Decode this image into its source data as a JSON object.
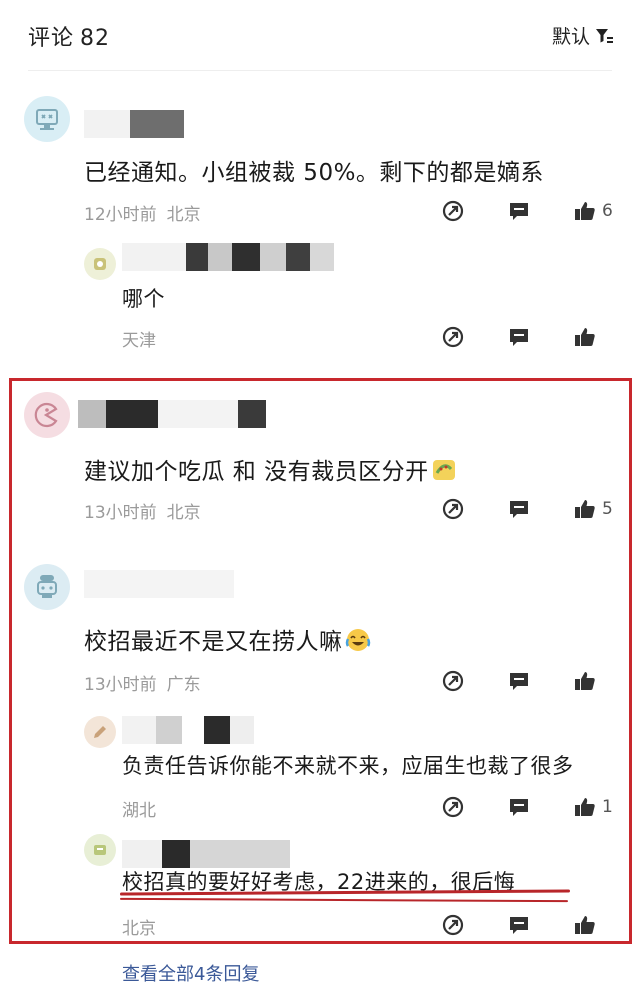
{
  "header": {
    "title": "评论",
    "count": "82",
    "sort_label": "默认"
  },
  "comments": [
    {
      "text": "已经通知。小组被裁 50%。剩下的都是嫡系",
      "time": "12小时前",
      "location": "北京",
      "likes": "6",
      "reply": {
        "text": "哪个",
        "location": "天津",
        "likes": ""
      }
    },
    {
      "text": "建议加个吃瓜 和 没有裁员区分开",
      "time": "13小时前",
      "location": "北京",
      "likes": "5"
    },
    {
      "text": "校招最近不是又在捞人嘛",
      "time": "13小时前",
      "location": "广东",
      "likes": "",
      "replies": [
        {
          "text": "负责任告诉你能不来就不来，应届生也裁了很多",
          "location": "湖北",
          "likes": "1"
        },
        {
          "text": "校招真的要好好考虑，22进来的，很后悔",
          "location": "北京",
          "likes": ""
        }
      ]
    }
  ],
  "footer": {
    "view_all": "查看全部4条回复"
  },
  "colors": {
    "highlight": "#c8282d",
    "link": "#3b5998",
    "meta": "#9a9a9a"
  },
  "icons": [
    "funnel-icon",
    "share-icon",
    "comment-icon",
    "thumbs-up-icon",
    "melon-emoji",
    "laugh-cry-emoji"
  ]
}
